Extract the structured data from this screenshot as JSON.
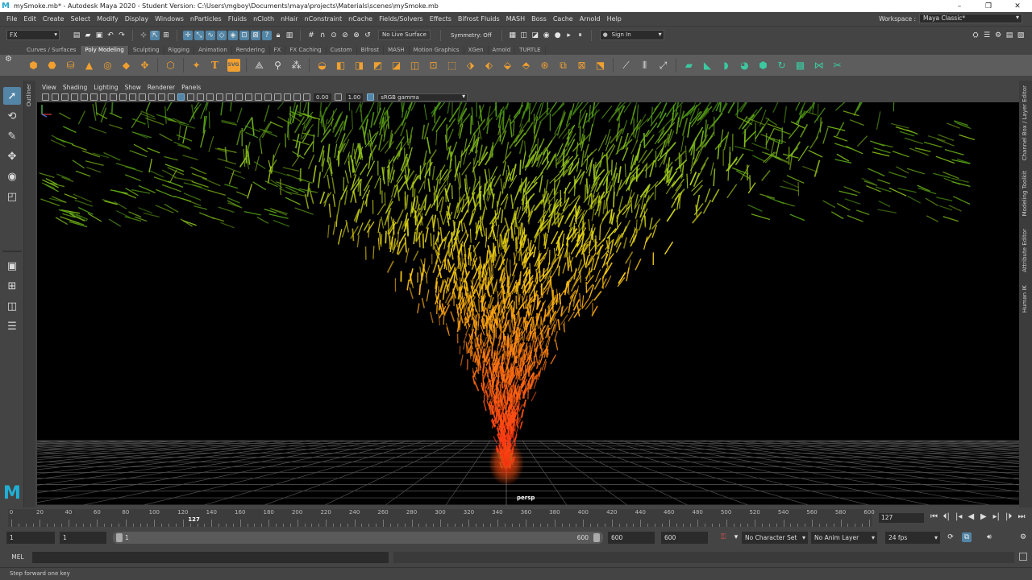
{
  "window": {
    "title": "mySmoke.mb* - Autodesk Maya 2020 - Student Version: C:\\Users\\mgboy\\Documents\\maya\\projects\\Materials\\scenes\\mySmoke.mb",
    "minimize": "–",
    "maximize": "❐",
    "close": "✕"
  },
  "menubar": [
    "File",
    "Edit",
    "Create",
    "Select",
    "Modify",
    "Display",
    "Windows",
    "nParticles",
    "Fluids",
    "nCloth",
    "nHair",
    "nConstraint",
    "nCache",
    "Fields/Solvers",
    "Effects",
    "Bifrost Fluids",
    "MASH",
    "Boss",
    "Cache",
    "Arnold",
    "Help"
  ],
  "workspace": {
    "label": "Workspace :",
    "value": "Maya Classic*"
  },
  "statusline": {
    "menuset": "FX",
    "live_surface": "No Live Surface",
    "symmetry": "Symmetry: Off",
    "sign_in": "Sign In"
  },
  "shelf_tabs": [
    "Curves / Surfaces",
    "Poly Modeling",
    "Sculpting",
    "Rigging",
    "Animation",
    "Rendering",
    "FX",
    "FX Caching",
    "Custom",
    "Bifrost",
    "MASH",
    "Motion Graphics",
    "XGen",
    "Arnold",
    "TURTLE"
  ],
  "active_shelf_tab": "Poly Modeling",
  "panel_menu": [
    "View",
    "Shading",
    "Lighting",
    "Show",
    "Renderer",
    "Panels"
  ],
  "panel_toolbar": {
    "exposure": "0.00",
    "gamma_value": "1.00",
    "color_space": "sRGB gamma"
  },
  "outliner_tab": "Outliner",
  "right_tabs": [
    "Channel Box / Layer Editor",
    "Modeling Toolkit",
    "Attribute Editor",
    "Human IK"
  ],
  "viewport": {
    "camera": "persp"
  },
  "timeslider": {
    "ticks": [
      "0",
      "20",
      "40",
      "60",
      "80",
      "100",
      "120",
      "140",
      "160",
      "180",
      "200",
      "220",
      "240",
      "260",
      "280",
      "300",
      "320",
      "340",
      "360",
      "380",
      "400",
      "420",
      "440",
      "460",
      "480",
      "500",
      "520",
      "540",
      "560",
      "580",
      "600"
    ],
    "current_marker": "127",
    "current_frame": "127",
    "buttons": [
      "⏮",
      "⏴|",
      "|◂",
      "◀",
      "▶",
      "▸|",
      "|⏵",
      "⏭"
    ]
  },
  "rangeslider": {
    "start": "1",
    "playback_start": "1",
    "bar_start": "1",
    "bar_end": "600",
    "playback_end": "600",
    "end": "600",
    "character_set": "No Character Set",
    "anim_layer": "No Anim Layer",
    "fps": "24 fps"
  },
  "commandline": {
    "language": "MEL"
  },
  "helpline": "Step forward one key"
}
